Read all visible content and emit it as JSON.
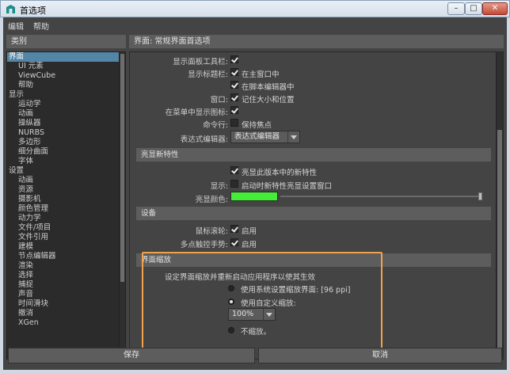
{
  "window": {
    "title": "首选项",
    "min": "–",
    "max": "□",
    "close": "✕"
  },
  "menu": [
    "编辑",
    "帮助"
  ],
  "categories_header": "类别",
  "categories": [
    "界面",
    "UI 元素",
    "ViewCube",
    "帮助",
    "显示",
    "运动学",
    "动画",
    "操纵器",
    "NURBS",
    "多边形",
    "细分曲面",
    "字体",
    "设置",
    "动画",
    "资源",
    "摄影机",
    "颜色管理",
    "动力学",
    "文件/项目",
    "文件引用",
    "建模",
    "节点编辑器",
    "渲染",
    "选择",
    "捕捉",
    "声音",
    "时间滑块",
    "撤消",
    "XGen"
  ],
  "pane_header": "界面: 常规界面首选项",
  "interface": {
    "panel_toolbar_label": "显示面板工具栏:",
    "title_bar_label": "显示标题栏:",
    "in_main_window": "在主窗口中",
    "in_script_editor": "在脚本编辑器中",
    "window_label": "窗口:",
    "remember_size": "记住大小和位置",
    "menu_icons_label": "在菜单中显示图标:",
    "command_line_label": "命令行:",
    "keep_focus": "保持焦点",
    "expr_editor_label": "表达式编辑器:",
    "expr_editor_value": "表达式编辑器"
  },
  "highlight_new": {
    "header": "亮显新特性",
    "highlight_version": "亮显此版本中的新特性",
    "show_label": "显示:",
    "show_at_startup": "启动时新特性亮显设置窗口",
    "color_label": "亮显颜色:",
    "color": "#44ee36"
  },
  "devices": {
    "header": "设备",
    "wheel_label": "鼠标滚轮:",
    "wheel_enable": "启用",
    "touch_label": "多点触控手势:",
    "touch_enable": "启用"
  },
  "scaling": {
    "header": "界面缩放",
    "hint": "设定界面缩放并重新启动应用程序以使其生效",
    "use_system": "使用系统设置缩放界面: [96 ppi]",
    "use_custom": "使用自定义缩放:",
    "custom_value": "100%",
    "no_scale": "不缩放。"
  },
  "buttons": {
    "save": "保存",
    "cancel": "取消"
  },
  "colors": {
    "accent": "#f0a34a",
    "selection": "#5285a6",
    "panel": "#444444"
  }
}
